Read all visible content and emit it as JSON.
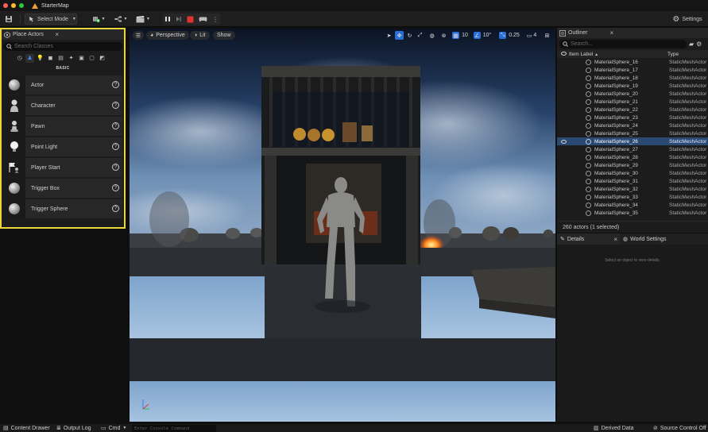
{
  "window": {
    "title": "StarterMap"
  },
  "toolbar": {
    "select_mode_label": "Select Mode",
    "settings_label": "Settings"
  },
  "place_actors": {
    "tab_label": "Place Actors",
    "search_placeholder": "Search Classes",
    "category_label": "BASIC",
    "categories": [
      "recent-icon",
      "basic-icon",
      "lights-icon",
      "shapes-icon",
      "cinematic-icon",
      "visual-effects-icon",
      "geometry-icon",
      "volumes-icon",
      "all-classes-icon"
    ],
    "items": [
      {
        "label": "Actor",
        "icon": "sphere-icon"
      },
      {
        "label": "Character",
        "icon": "character-icon"
      },
      {
        "label": "Pawn",
        "icon": "pawn-icon"
      },
      {
        "label": "Point Light",
        "icon": "point-light-icon"
      },
      {
        "label": "Player Start",
        "icon": "player-start-icon"
      },
      {
        "label": "Trigger Box",
        "icon": "trigger-box-icon"
      },
      {
        "label": "Trigger Sphere",
        "icon": "trigger-sphere-icon"
      }
    ]
  },
  "viewport": {
    "perspective_label": "Perspective",
    "lit_label": "Lit",
    "show_label": "Show",
    "grid_snap": "10",
    "rotation_snap": "10°",
    "scale_snap": "0.25",
    "camera_speed": "4"
  },
  "outliner": {
    "tab_label": "Outliner",
    "search_placeholder": "Search...",
    "col_label": "Item Label",
    "col_type": "Type",
    "rows": [
      {
        "name": "MaterialSphere_16",
        "type": "StaticMeshActor",
        "selected": false
      },
      {
        "name": "MaterialSphere_17",
        "type": "StaticMeshActor",
        "selected": false
      },
      {
        "name": "MaterialSphere_18",
        "type": "StaticMeshActor",
        "selected": false
      },
      {
        "name": "MaterialSphere_19",
        "type": "StaticMeshActor",
        "selected": false
      },
      {
        "name": "MaterialSphere_20",
        "type": "StaticMeshActor",
        "selected": false
      },
      {
        "name": "MaterialSphere_21",
        "type": "StaticMeshActor",
        "selected": false
      },
      {
        "name": "MaterialSphere_22",
        "type": "StaticMeshActor",
        "selected": false
      },
      {
        "name": "MaterialSphere_23",
        "type": "StaticMeshActor",
        "selected": false
      },
      {
        "name": "MaterialSphere_24",
        "type": "StaticMeshActor",
        "selected": false
      },
      {
        "name": "MaterialSphere_25",
        "type": "StaticMeshActor",
        "selected": false
      },
      {
        "name": "MaterialSphere_26",
        "type": "StaticMeshActor",
        "selected": true
      },
      {
        "name": "MaterialSphere_27",
        "type": "StaticMeshActor",
        "selected": false
      },
      {
        "name": "MaterialSphere_28",
        "type": "StaticMeshActor",
        "selected": false
      },
      {
        "name": "MaterialSphere_29",
        "type": "StaticMeshActor",
        "selected": false
      },
      {
        "name": "MaterialSphere_30",
        "type": "StaticMeshActor",
        "selected": false
      },
      {
        "name": "MaterialSphere_31",
        "type": "StaticMeshActor",
        "selected": false
      },
      {
        "name": "MaterialSphere_32",
        "type": "StaticMeshActor",
        "selected": false
      },
      {
        "name": "MaterialSphere_33",
        "type": "StaticMeshActor",
        "selected": false
      },
      {
        "name": "MaterialSphere_34",
        "type": "StaticMeshActor",
        "selected": false
      },
      {
        "name": "MaterialSphere_35",
        "type": "StaticMeshActor",
        "selected": false
      }
    ],
    "footer": "260 actors (1 selected)"
  },
  "details": {
    "tab_label": "Details",
    "world_settings_label": "World Settings",
    "empty_message": "Select an object to view details."
  },
  "statusbar": {
    "content_drawer": "Content Drawer",
    "output_log": "Output Log",
    "cmd_label": "Cmd",
    "console_placeholder": "Enter Console Command",
    "derived_data": "Derived Data",
    "source_control": "Source Control Off"
  },
  "colors": {
    "accent_yellow": "#e9d63a",
    "accent_blue": "#2a6fd6",
    "selection_blue": "#2a4a74",
    "stop_red": "#e0332b"
  }
}
